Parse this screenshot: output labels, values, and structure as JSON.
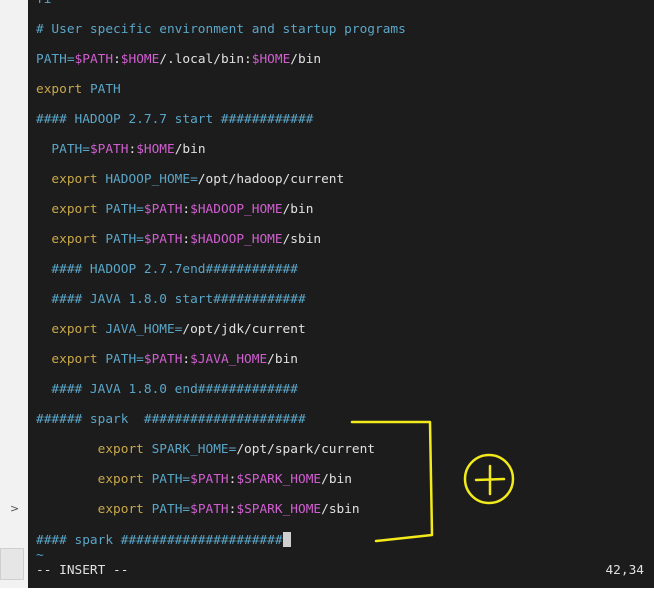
{
  "editor": {
    "top_partial": "fi",
    "lines": [
      [
        {
          "t": "# User specific environment and startup programs",
          "c": "comment"
        }
      ],
      [
        {
          "t": "PATH=",
          "c": "id"
        },
        {
          "t": "$PATH",
          "c": "var"
        },
        {
          "t": ":",
          "c": "plain"
        },
        {
          "t": "$HOME",
          "c": "var"
        },
        {
          "t": "/.local/bin:",
          "c": "plain"
        },
        {
          "t": "$HOME",
          "c": "var"
        },
        {
          "t": "/bin",
          "c": "plain"
        }
      ],
      [
        {
          "t": "export ",
          "c": "kw"
        },
        {
          "t": "PATH",
          "c": "id"
        }
      ],
      [
        {
          "t": "#### HADOOP 2.7.7 start ############",
          "c": "comment"
        }
      ],
      [
        {
          "t": "  PATH=",
          "c": "id"
        },
        {
          "t": "$PATH",
          "c": "var"
        },
        {
          "t": ":",
          "c": "plain"
        },
        {
          "t": "$HOME",
          "c": "var"
        },
        {
          "t": "/bin",
          "c": "plain"
        }
      ],
      [
        {
          "t": "  export ",
          "c": "kw"
        },
        {
          "t": "HADOOP_HOME=",
          "c": "id"
        },
        {
          "t": "/opt/hadoop/current",
          "c": "plain"
        }
      ],
      [
        {
          "t": "  export ",
          "c": "kw"
        },
        {
          "t": "PATH=",
          "c": "id"
        },
        {
          "t": "$PATH",
          "c": "var"
        },
        {
          "t": ":",
          "c": "plain"
        },
        {
          "t": "$HADOOP_HOME",
          "c": "var"
        },
        {
          "t": "/bin",
          "c": "plain"
        }
      ],
      [
        {
          "t": "  export ",
          "c": "kw"
        },
        {
          "t": "PATH=",
          "c": "id"
        },
        {
          "t": "$PATH",
          "c": "var"
        },
        {
          "t": ":",
          "c": "plain"
        },
        {
          "t": "$HADOOP_HOME",
          "c": "var"
        },
        {
          "t": "/sbin",
          "c": "plain"
        }
      ],
      [
        {
          "t": "  #### HADOOP 2.7.7end############",
          "c": "comment"
        }
      ],
      [
        {
          "t": "  #### JAVA 1.8.0 start############",
          "c": "comment"
        }
      ],
      [
        {
          "t": "  export ",
          "c": "kw"
        },
        {
          "t": "JAVA_HOME=",
          "c": "id"
        },
        {
          "t": "/opt/jdk/current",
          "c": "plain"
        }
      ],
      [
        {
          "t": "  export ",
          "c": "kw"
        },
        {
          "t": "PATH=",
          "c": "id"
        },
        {
          "t": "$PATH",
          "c": "var"
        },
        {
          "t": ":",
          "c": "plain"
        },
        {
          "t": "$JAVA_HOME",
          "c": "var"
        },
        {
          "t": "/bin",
          "c": "plain"
        }
      ],
      [
        {
          "t": "  #### JAVA 1.8.0 end#############",
          "c": "comment"
        }
      ],
      [
        {
          "t": "###### spark  #####################",
          "c": "comment"
        }
      ],
      [
        {
          "t": "        export ",
          "c": "kw"
        },
        {
          "t": "SPARK_HOME=",
          "c": "id"
        },
        {
          "t": "/opt/spark/current",
          "c": "plain"
        }
      ],
      [
        {
          "t": "        export ",
          "c": "kw"
        },
        {
          "t": "PATH=",
          "c": "id"
        },
        {
          "t": "$PATH",
          "c": "var"
        },
        {
          "t": ":",
          "c": "plain"
        },
        {
          "t": "$SPARK_HOME",
          "c": "var"
        },
        {
          "t": "/bin",
          "c": "plain"
        }
      ],
      [
        {
          "t": "        export ",
          "c": "kw"
        },
        {
          "t": "PATH=",
          "c": "id"
        },
        {
          "t": "$PATH",
          "c": "var"
        },
        {
          "t": ":",
          "c": "plain"
        },
        {
          "t": "$SPARK_HOME",
          "c": "var"
        },
        {
          "t": "/sbin",
          "c": "plain"
        }
      ],
      [
        {
          "t": "#### spark #####################",
          "c": "comment"
        }
      ]
    ],
    "tilde": "~",
    "mode": "-- INSERT --",
    "cursor_position": "42,34"
  },
  "gutter": {
    "arrow": ">"
  },
  "colors": {
    "background": "#1c1c1c",
    "comment": "#5aa6c8",
    "keyword": "#c8a84a",
    "variable": "#d05fd0",
    "annotation": "#f2ea1a"
  }
}
